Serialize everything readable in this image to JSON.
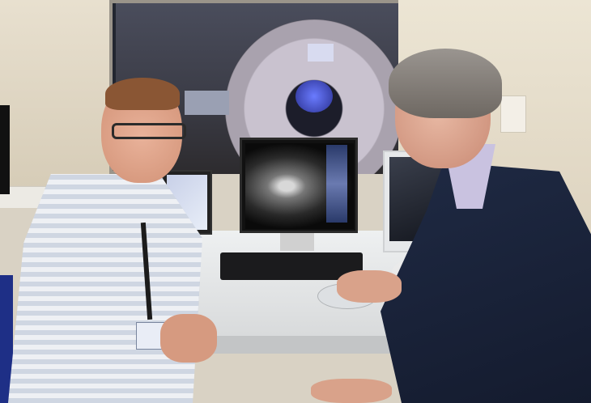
{
  "scene": {
    "description_label": "",
    "colors": {
      "wall": "#e8e0cf",
      "scanner_window": "#2d2b2e",
      "desk": "#eef0f1",
      "shirt_left": "#eef0f4",
      "sweater_right": "#1f2a44"
    },
    "objects": [
      "mri-scanner",
      "monitor-main",
      "monitor-left",
      "monitor-right",
      "keyboard",
      "mouse",
      "person-left",
      "person-right"
    ]
  }
}
